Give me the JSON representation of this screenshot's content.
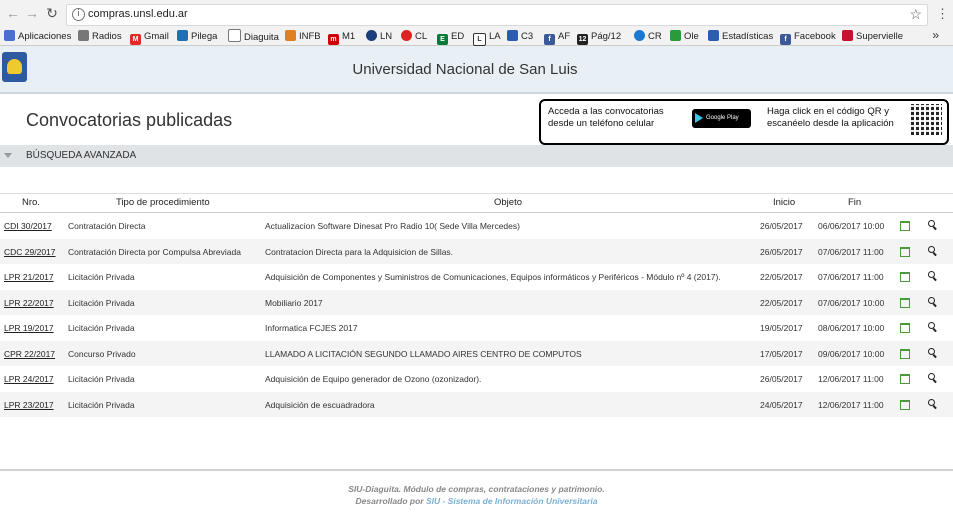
{
  "browser": {
    "url": "compras.unsl.edu.ar",
    "bookmarks": [
      "Aplicaciones",
      "Radios",
      "Gmail",
      "Pilega",
      "Diaguita",
      "INFB",
      "M1",
      "LN",
      "CL",
      "ED",
      "LA",
      "C3",
      "AF",
      "Pág/12",
      "CR",
      "Ole",
      "Estadísticas",
      "Facebook",
      "Supervielle"
    ],
    "bookmark_more": "»"
  },
  "header": {
    "title": "Universidad Nacional de San Luis"
  },
  "page": {
    "title": "Convocatorias publicadas"
  },
  "promo": {
    "text_left": "Acceda a las convocatorias desde un teléfono celular",
    "play_badge": "Google Play",
    "text_right": "Haga click en el código QR y escanéelo desde la aplicación"
  },
  "search": {
    "label": "BÚSQUEDA AVANZADA"
  },
  "table": {
    "headers": {
      "nro": "Nro.",
      "tipo": "Tipo de procedimiento",
      "objeto": "Objeto",
      "inicio": "Inicio",
      "fin": "Fin"
    },
    "rows": [
      {
        "nro": "CDI 30/2017",
        "tipo": "Contratación Directa",
        "objeto": "Actualizacion Software Dinesat Pro Radio 10( Sede Villa Mercedes)",
        "inicio": "26/05/2017",
        "fin": "06/06/2017 10:00"
      },
      {
        "nro": "CDC 29/2017",
        "tipo": "Contratación Directa por Compulsa Abreviada",
        "objeto": "Contratacion Directa para la Adquisicion de Sillas.",
        "inicio": "26/05/2017",
        "fin": "07/06/2017 11:00"
      },
      {
        "nro": "LPR 21/2017",
        "tipo": "Licitación Privada",
        "objeto": "Adquisición de Componentes y Suministros de Comunicaciones, Equipos informáticos y Periféricos - Módulo nº 4 (2017).",
        "inicio": "22/05/2017",
        "fin": "07/06/2017 11:00"
      },
      {
        "nro": "LPR 22/2017",
        "tipo": "Licitación Privada",
        "objeto": "Mobiliario 2017",
        "inicio": "22/05/2017",
        "fin": "07/06/2017 10:00"
      },
      {
        "nro": "LPR 19/2017",
        "tipo": "Licitación Privada",
        "objeto": "Informatica FCJES 2017",
        "inicio": "19/05/2017",
        "fin": "08/06/2017 10:00"
      },
      {
        "nro": "CPR 22/2017",
        "tipo": "Concurso Privado",
        "objeto": "LLAMADO A LICITACIÓN SEGUNDO LLAMADO AIRES CENTRO DE COMPUTOS",
        "inicio": "17/05/2017",
        "fin": "09/06/2017 10:00"
      },
      {
        "nro": "LPR 24/2017",
        "tipo": "Licitación Privada",
        "objeto": "Adquisición de Equipo generador de Ozono (ozonizador).",
        "inicio": "26/05/2017",
        "fin": "12/06/2017 11:00"
      },
      {
        "nro": "LPR 23/2017",
        "tipo": "Licitación Privada",
        "objeto": "Adquisición de escuadradora",
        "inicio": "24/05/2017",
        "fin": "12/06/2017 11:00"
      }
    ]
  },
  "footer": {
    "line1": "SIU-Diaguita. Módulo de compras, contrataciones y patrimonio.",
    "line2_prefix": "Desarrollado por",
    "line2_link": "SIU - Sistema de Información Universitaria"
  }
}
